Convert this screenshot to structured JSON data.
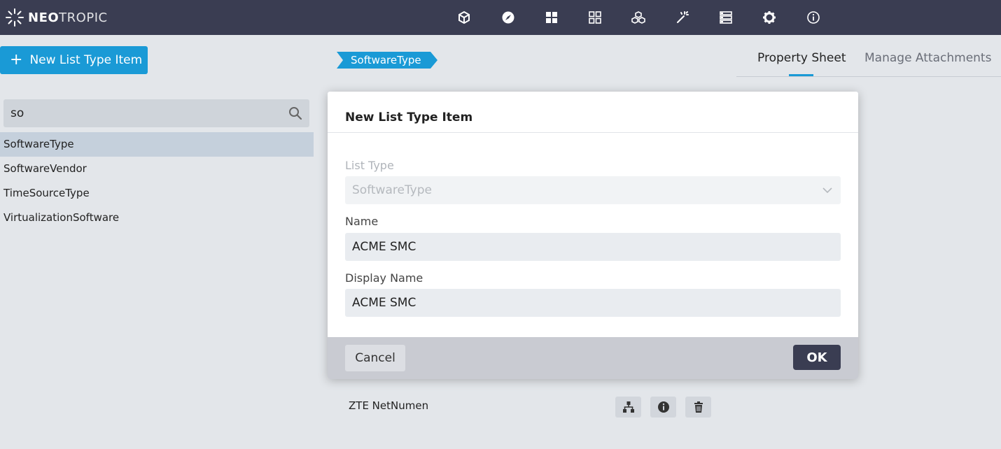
{
  "app": {
    "logo_bold": "NEO",
    "logo_light": "TROPIC"
  },
  "topnav": {
    "icons": [
      "cube-icon",
      "compass-icon",
      "grid-filled-icon",
      "grid-outline-icon",
      "cubes-icon",
      "magic-wand-icon",
      "list-icon",
      "gear-icon",
      "info-icon"
    ]
  },
  "left_panel": {
    "new_button_label": "New List Type Item",
    "search_value": "so",
    "items": [
      {
        "label": "SoftwareType",
        "selected": true
      },
      {
        "label": "SoftwareVendor",
        "selected": false
      },
      {
        "label": "TimeSourceType",
        "selected": false
      },
      {
        "label": "VirtualizationSoftware",
        "selected": false
      }
    ]
  },
  "breadcrumb": {
    "label": "SoftwareType"
  },
  "tabs": {
    "active": "Property Sheet",
    "inactive": "Manage Attachments"
  },
  "table": {
    "visible_row_label": "ZTE NetNumen"
  },
  "modal": {
    "title": "New List Type Item",
    "list_type_label": "List Type",
    "list_type_value": "SoftwareType",
    "name_label": "Name",
    "name_value": "ACME SMC",
    "display_name_label": "Display Name",
    "display_name_value": "ACME SMC",
    "cancel_label": "Cancel",
    "ok_label": "OK"
  },
  "colors": {
    "topbar": "#3a3d52",
    "accent": "#1a9ad6",
    "selected_row": "#c5d0dc"
  }
}
